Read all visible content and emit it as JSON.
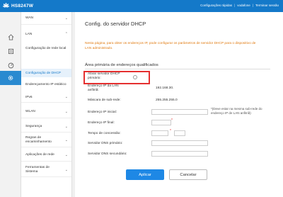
{
  "header": {
    "brand": "HS8247W",
    "links": [
      "Configurações rápidas",
      "vodafone",
      "Terminar sessão"
    ]
  },
  "iconbar": {
    "items": [
      "home-icon",
      "page-icon",
      "gauge-icon",
      "gear-icon"
    ],
    "active": "gear-icon"
  },
  "nav": {
    "wan": "WAN",
    "lan": "LAN",
    "lan_sub": [
      "Configuração de rede local",
      "Configuração de DHCP",
      "Endereçamento IP estático"
    ],
    "ipv6": "IPv6",
    "wlan": "WLAN",
    "security": "Segurança",
    "routing": [
      "Regras de",
      "encaminhamento"
    ],
    "network_apps": "Aplicações de rede",
    "system_tools": [
      "Ferramentas de",
      "Sistema"
    ]
  },
  "main": {
    "title": "Config. do servidor DHCP",
    "intro": "Nesta página, para obter os endereços IP, pode configurar os parâmetros de servidor DHCP para o dispositivo de LAN administrado.",
    "section": "Área primária de endereços qualificados",
    "fields": {
      "enable_dhcp": [
        "Ativar servidor DHCP",
        "primário:"
      ],
      "lan_ip": [
        "Endereço IP da LAN",
        "anfitriã:"
      ],
      "lan_ip_value": "192.168.30.",
      "subnet_mask": "Máscara de sub-rede:",
      "subnet_mask_value": "255.255.255.0",
      "start_ip": "Endereço IP inicial:",
      "start_ip_note": "*(Deve estar na mesma sub-rede do endereço IP de LAN anfitriã)",
      "end_ip": "Endereço IP final:",
      "lease_time": "Tempo de concessão:",
      "dns_primary": "Servidor DNS primário:",
      "dns_secondary": "Servidor DNS secundário:"
    },
    "apply": "Aplicar",
    "cancel": "Cancelar"
  },
  "colors": {
    "header": "#1479c9",
    "accent": "#1e88e5",
    "intro_text": "#e07a10",
    "highlight": "#e53030"
  }
}
